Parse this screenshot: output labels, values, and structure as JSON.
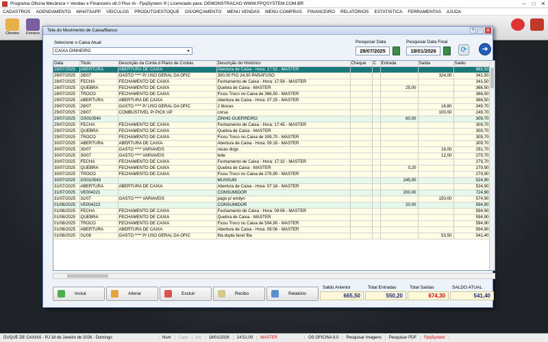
{
  "window": {
    "title": "Programa Oficina Mecânica + Vendas e Financeiro v8.0 Plus IA - FpqSystem ® | Licenciado para: DEMONSTRACAO WWW.FPQSYSTEM.COM.BR"
  },
  "menu": [
    "CADASTROS",
    "AGENDAMENTO",
    "WHATSAPP",
    "VEICULOS",
    "PRODUTO/ESTOQUE",
    "OS/ORÇAMENTO",
    "MENU VENDAS",
    "MENU COMPRAS",
    "FINANCEIRO",
    "RELATÓRIOS",
    "ESTATISTICA",
    "FERRAMENTAS",
    "AJUDA"
  ],
  "toolbar": {
    "clientes": "Clientes",
    "fornece": "Fornece"
  },
  "dialog": {
    "title": "Tela do Movimento de Caixa/Banco",
    "select_label": "Selecione o Caixa Atual",
    "selected_caixa": "CAIXA DINHEIRO",
    "date_start_label": "Pesquisar Data",
    "date_start": "28/07/2025",
    "date_end_label": "Pesquisar Data Final",
    "date_end": "18/01/2026"
  },
  "table": {
    "headers": [
      "Data",
      "Titulo",
      "Descrição da Conta d Plano de Contas",
      "Descrição do Histórico",
      "Cheque",
      "C",
      "Entrada",
      "Saída",
      "Saldo"
    ],
    "rows": [
      [
        "28/07/2025",
        "ABERTURA",
        "ABERTURA DE CAIXA",
        "Abertura de Caixa - Hora: 17:52 - MASTER",
        "",
        "",
        "",
        "",
        "665,50"
      ],
      [
        "28/07/2025",
        "28/07",
        "GASTO **** P/ USO GERAL DA OFIC",
        "300,00 FIO 24,00 PARAFUSO",
        "",
        "",
        "",
        "324,00",
        "341,50"
      ],
      [
        "28/07/2025",
        "FECHA",
        "FECHAMENTO DE CAIXA",
        "Fechamento de Caixa - Hora: 17:56 - MASTER",
        "",
        "",
        "",
        "",
        "341,50"
      ],
      [
        "28/07/2025",
        "QUEBRA",
        "FECHAMENTO DE CAIXA",
        "Quebra de Caixa - MASTER",
        "",
        "",
        "25,00",
        "",
        "366,50"
      ],
      [
        "28/07/2025",
        "TROCO",
        "FECHAMENTO DE CAIXA",
        "Ficou Troco no Caixa de      366,50 - MASTER",
        "",
        "",
        "",
        "",
        "366,50"
      ],
      [
        "29/07/2025",
        "ABERTURA",
        "ABERTURA DE CAIXA",
        "Abertura de Caixa - Hora: 07:25 - MASTER",
        "",
        "",
        "",
        "",
        "366,50"
      ],
      [
        "29/07/2025",
        "29/07",
        "GASTO **** P/ USO GERAL DA OFIC",
        "2 blocas",
        "",
        "",
        "",
        "16,80",
        "349,70"
      ],
      [
        "29/07/2025",
        "29/07",
        "COMBUSTÍVEL P/ PICK UP",
        "corsa",
        "",
        "",
        "",
        "100,00",
        "249,70"
      ],
      [
        "29/07/2025",
        "OS010540",
        "",
        "ZINHO GUERREIRO",
        "",
        "",
        "60,00",
        "",
        "309,70"
      ],
      [
        "29/07/2025",
        "FECHA",
        "FECHAMENTO DE CAIXA",
        "Fechamento de Caixa - Hora: 17:45 - MASTER",
        "",
        "",
        "",
        "",
        "309,70"
      ],
      [
        "29/07/2025",
        "QUEBRA",
        "FECHAMENTO DE CAIXA",
        "Quebra de Caixa - MASTER",
        "",
        "",
        "",
        "",
        "309,70"
      ],
      [
        "29/07/2025",
        "TROCO",
        "FECHAMENTO DE CAIXA",
        "Ficou Troco no Caixa de      309,70 - MASTER",
        "",
        "",
        "",
        "",
        "309,70"
      ],
      [
        "30/07/2025",
        "ABERTURA",
        "ABERTURA DE CAIXA",
        "Abertura de Caixa - Hora: 09:18 - MASTER",
        "",
        "",
        "",
        "",
        "309,70"
      ],
      [
        "30/07/2025",
        "30/07",
        "GASTO **** VARIAVEIS",
        "racao dogs",
        "",
        "",
        "",
        "18,00",
        "291,70"
      ],
      [
        "30/07/2025",
        "30/07",
        "GASTO **** VARIAVEIS",
        "leite",
        "",
        "",
        "",
        "12,00",
        "279,70"
      ],
      [
        "30/07/2025",
        "FECHA",
        "FECHAMENTO DE CAIXA",
        "Fechamento de Caixa - Hora: 17:32 - MASTER",
        "",
        "",
        "",
        "",
        "279,70"
      ],
      [
        "30/07/2025",
        "QUEBRA",
        "FECHAMENTO DE CAIXA",
        "Quebra de Caixa - MASTER",
        "",
        "",
        "0,20",
        "",
        "279,90"
      ],
      [
        "30/07/2025",
        "TROCO",
        "FECHAMENTO DE CAIXA",
        "Ficou Troco no Caixa de      279,90 - MASTER",
        "",
        "",
        "",
        "",
        "279,90"
      ],
      [
        "30/07/2025",
        "OS010543",
        "",
        "MUSSUM",
        "",
        "",
        "245,00",
        "",
        "524,90"
      ],
      [
        "31/07/2025",
        "ABERTURA",
        "ABERTURA DE CAIXA",
        "Abertura de Caixa - Hora: 07:18 - MASTER",
        "",
        "",
        "",
        "",
        "524,90"
      ],
      [
        "31/07/2025",
        "VE004221",
        "",
        "CONSUMIDOR",
        "",
        "",
        "200,00",
        "",
        "724,90"
      ],
      [
        "31/07/2025",
        "31/07",
        "GASTO **** VARIAVEIS",
        "pago p/ emilyn",
        "",
        "",
        "",
        "150,00",
        "574,90"
      ],
      [
        "01/08/2025",
        "VE004222",
        "",
        "CONSUMIDOR",
        "",
        "",
        "20,00",
        "",
        "594,90"
      ],
      [
        "01/08/2025",
        "FECHA",
        "FECHAMENTO DE CAIXA",
        "Fechamento de Caixa - Hora: 09:06 - MASTER",
        "",
        "",
        "",
        "",
        "594,90"
      ],
      [
        "01/08/2025",
        "QUEBRA",
        "FECHAMENTO DE CAIXA",
        "Quebra de Caixa - MASTER",
        "",
        "",
        "",
        "",
        "594,90"
      ],
      [
        "01/08/2025",
        "TROCO",
        "FECHAMENTO DE CAIXA",
        "Ficou Troco no Caixa de      594,90 - MASTER",
        "",
        "",
        "",
        "",
        "594,90"
      ],
      [
        "01/08/2025",
        "ABERTURA",
        "ABERTURA DE CAIXA",
        "Abertura de Caixa - Hora: 09:06 - MASTER",
        "",
        "",
        "",
        "",
        "594,90"
      ],
      [
        "01/08/2025",
        "01/08",
        "GASTO **** P/ USO GERAL DA OFIC",
        "fita dupla face/ fita",
        "",
        "",
        "",
        "53,50",
        "541,40"
      ]
    ]
  },
  "buttons": {
    "incluir": "Incluir",
    "alterar": "Alterar",
    "excluir": "Excluir",
    "recibo": "Recibo",
    "relatorio": "Relatório"
  },
  "totals": {
    "saldo_anterior_label": "Saldo Anterior",
    "saldo_anterior": "665,50",
    "total_entradas_label": "Total Entradas",
    "total_entradas": "550,20",
    "total_saidas_label": "Total Saídas",
    "total_saidas": "674,30",
    "saldo_atual_label": "SALDO ATUAL",
    "saldo_atual": "541,40"
  },
  "status": {
    "location": "DUQUE DE CAXIAS - RJ 18 de Janeiro de 2026 - Domingo",
    "num": "Num",
    "caps": "Caps",
    "ins": "Ins",
    "date": "18/01/2026",
    "time": "14:51:09",
    "user": "MASTER",
    "os": "OS OFICINA 8.0",
    "pesq_imagens": "Pesquisar Imagens",
    "pesq_pdf": "Pesquisar PDF",
    "brand": "FpqSystem"
  }
}
